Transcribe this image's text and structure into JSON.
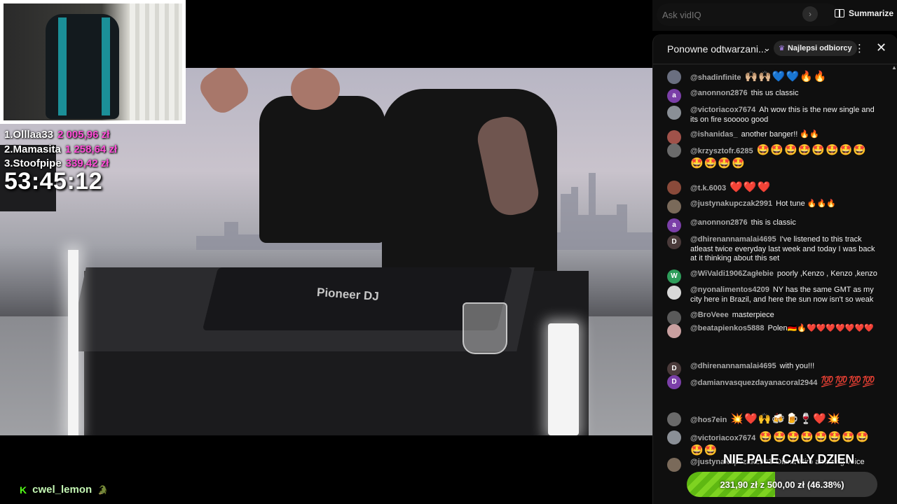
{
  "leaderboard": [
    {
      "name": "1.Olllaa33",
      "amount": "2 005,96 zł"
    },
    {
      "name": "2.Mamasita",
      "amount": "1 258,64 zł"
    },
    {
      "name": "3.Stoofpipe",
      "amount": "339,42 zł"
    }
  ],
  "timer": "53:45:12",
  "video": {
    "deck_label": "Pioneer DJ"
  },
  "streamer": {
    "platform_icon": "K",
    "username": "cwel_lemon",
    "emote": "🐊"
  },
  "vidiq": {
    "placeholder": "Ask vidIQ",
    "send_icon": "›",
    "summarize_label": "Summarize"
  },
  "chat": {
    "title": "Ponowne odtwarzani...",
    "chevron": "⌄",
    "top_fans_label": "Najlepsi odbiorcy",
    "top_fans_icon": "♛",
    "more_icon": "⋮",
    "close_icon": "✕",
    "scroll_up_icon": "▲",
    "messages": [
      {
        "author": "@shadinfinite",
        "text": "🙌🏼🙌🏼💙💙🔥🔥",
        "emoji": true,
        "avatar": "",
        "avatar_color": "#6a6f80"
      },
      {
        "author": "@anonnon2876",
        "text": "this us classic",
        "emoji": false,
        "avatar": "a",
        "avatar_color": "#7b3fa8"
      },
      {
        "author": "@victoriacox7674",
        "text": "Ah wow this is the new single and its on fire sooooo good",
        "emoji": false,
        "avatar": "",
        "avatar_color": "#8a8f96"
      },
      {
        "author": "@ishanidas_",
        "text": "another banger!! 🔥🔥",
        "emoji": false,
        "avatar": "",
        "avatar_color": "#a0524a"
      },
      {
        "author": "@krzysztofr.6285",
        "text": "🤩🤩🤩🤩🤩🤩🤩🤩🤩🤩🤩🤩",
        "emoji": true,
        "avatar": "",
        "avatar_color": "#6b6b6b"
      },
      {
        "author": "@t.k.6003",
        "text": "❤️❤️❤️",
        "emoji": true,
        "avatar": "",
        "avatar_color": "#8a4a3a"
      },
      {
        "author": "@justynakupczak2991",
        "text": "Hot tune 🔥🔥🔥",
        "emoji": false,
        "avatar": "",
        "avatar_color": "#7a6a5a"
      },
      {
        "author": "@anonnon2876",
        "text": "this is classic",
        "emoji": false,
        "avatar": "a",
        "avatar_color": "#7b3fa8"
      },
      {
        "author": "@dhirenannamalai4695",
        "text": "I've listened to this track atleast twice everyday last week and today I was back at it thinking about this set",
        "emoji": false,
        "avatar": "D",
        "avatar_color": "#4a3a3a"
      },
      {
        "author": "@WiValdi1906Zagłebie",
        "text": "poorly ,Kenzo , Kenzo ,kenzo",
        "emoji": false,
        "avatar": "W",
        "avatar_color": "#2e9d5a"
      },
      {
        "author": "@nyonalimentos4209",
        "text": "NY has the same GMT as my city here in Brazil, and here the sun now isn't so weak",
        "emoji": false,
        "avatar": "",
        "avatar_color": "#d8d8d8"
      },
      {
        "author": "@BroVeee",
        "text": "masterpiece",
        "emoji": false,
        "avatar": "",
        "avatar_color": "#5a5a5a"
      },
      {
        "author": "@beatapienkos5888",
        "text": "Polen🇩🇪🔥❤️❤️❤️❤️❤️❤️❤️",
        "emoji": false,
        "avatar": "",
        "avatar_color": "#c9a0a0"
      },
      {
        "author": "@dhirenannamalai4695",
        "text": "with you!!!",
        "emoji": false,
        "avatar": "D",
        "avatar_color": "#4a3a3a"
      },
      {
        "author": "@damianvasquezdayanacoral2944",
        "text": "💯💯💯💯",
        "emoji": true,
        "avatar": "D",
        "avatar_color": "#7b3fa8"
      },
      {
        "author": "@hos7ein",
        "text": "💥❤️🙌🍻🍺🍷❤️💥",
        "emoji": true,
        "avatar": "",
        "avatar_color": "#6a6a6a"
      },
      {
        "author": "@victoriacox7674",
        "text": "🤩🤩🤩🤩🤩🤩🤩🤩🤩🤩",
        "emoji": true,
        "avatar": "",
        "avatar_color": "#8a8f96"
      },
      {
        "author": "@justynakupczak2991",
        "text": "Diana Miro amazing voice",
        "emoji": false,
        "avatar": "",
        "avatar_color": "#7a6a5a"
      }
    ]
  },
  "goal": {
    "caption": "NIE PALE CALY DZIEN",
    "current": "231,90 zł",
    "separator": "z",
    "target": "500,00 zł",
    "percent_label": "(46.38%)",
    "progress": 0.4638
  }
}
